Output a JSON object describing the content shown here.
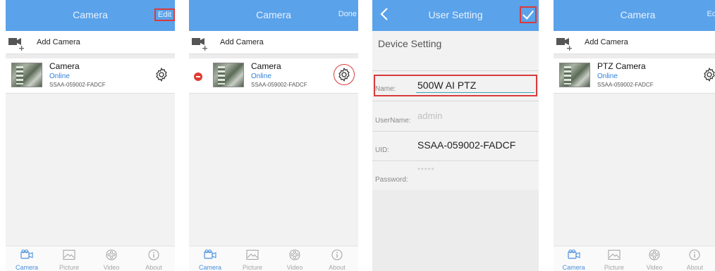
{
  "screens": [
    {
      "title": "Camera",
      "right_button": "Edit",
      "add_camera_label": "Add Camera",
      "camera": {
        "name": "Camera",
        "status": "Online",
        "uid": "SSAA-059002-FADCF"
      },
      "tabs": [
        "Camera",
        "Picture",
        "Video",
        "About"
      ]
    },
    {
      "title": "Camera",
      "right_button": "Done",
      "add_camera_label": "Add Camera",
      "camera": {
        "name": "Camera",
        "status": "Online",
        "uid": "SSAA-059002-FADCF"
      },
      "tabs": [
        "Camera",
        "Picture",
        "Video",
        "About"
      ]
    },
    {
      "title": "User Setting",
      "section_label": "Device Setting",
      "fields": {
        "name_label": "Name:",
        "name_value": "500W AI PTZ",
        "username_label": "UserName:",
        "username_placeholder": "admin",
        "uid_label": "UID:",
        "uid_value": "SSAA-059002-FADCF",
        "password_label": "Password:",
        "password_value": "*****"
      }
    },
    {
      "title": "Camera",
      "right_button": "Ed",
      "add_camera_label": "Add Camera",
      "camera": {
        "name": "PTZ Camera",
        "status": "Online",
        "uid": "SSAA-059002-FADCF"
      },
      "tabs": [
        "Camera",
        "Picture",
        "Video",
        "About"
      ]
    }
  ],
  "colors": {
    "header_blue": "#5aa2ea",
    "status_blue": "#2e7fd8",
    "highlight_red": "#d93b3b",
    "delete_red": "#e03a32",
    "active_tab": "#4b90de",
    "inactive_tab": "#a7a7a7"
  },
  "icons": [
    "video-camera-add-icon",
    "gear-icon",
    "delete-minus-icon",
    "camera-tab-icon",
    "picture-tab-icon",
    "video-tab-icon",
    "about-info-icon",
    "back-chevron-icon",
    "check-icon"
  ]
}
